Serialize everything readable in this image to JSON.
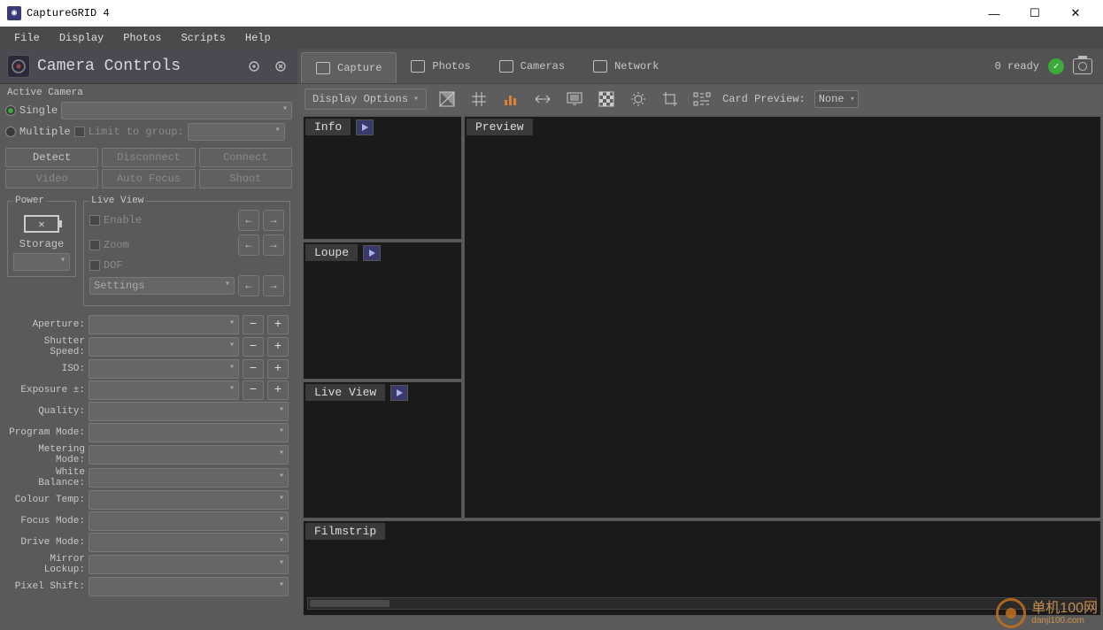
{
  "window": {
    "title": "CaptureGRID 4"
  },
  "menubar": [
    "File",
    "Display",
    "Photos",
    "Scripts",
    "Help"
  ],
  "sidebar": {
    "title": "Camera Controls",
    "active_camera_label": "Active Camera",
    "single_label": "Single",
    "multiple_label": "Multiple",
    "limit_label": "Limit to group:",
    "buttons": {
      "detect": "Detect",
      "disconnect": "Disconnect",
      "connect": "Connect",
      "video": "Video",
      "autofocus": "Auto Focus",
      "shoot": "Shoot"
    },
    "power": {
      "legend": "Power",
      "storage_label": "Storage"
    },
    "liveview": {
      "legend": "Live View",
      "enable": "Enable",
      "zoom": "Zoom",
      "dof": "DOF",
      "settings": "Settings"
    },
    "controls": [
      {
        "label": "Aperture:",
        "stepper": true
      },
      {
        "label": "Shutter Speed:",
        "stepper": true
      },
      {
        "label": "ISO:",
        "stepper": true
      },
      {
        "label": "Exposure ±:",
        "stepper": true
      },
      {
        "label": "Quality:",
        "stepper": false
      },
      {
        "label": "Program Mode:",
        "stepper": false
      },
      {
        "label": "Metering Mode:",
        "stepper": false
      },
      {
        "label": "White Balance:",
        "stepper": false
      },
      {
        "label": "Colour Temp:",
        "stepper": false
      },
      {
        "label": "Focus Mode:",
        "stepper": false
      },
      {
        "label": "Drive Mode:",
        "stepper": false
      },
      {
        "label": "Mirror Lockup:",
        "stepper": false
      },
      {
        "label": "Pixel Shift:",
        "stepper": false
      }
    ]
  },
  "tabs": [
    {
      "label": "Capture",
      "active": true
    },
    {
      "label": "Photos",
      "active": false
    },
    {
      "label": "Cameras",
      "active": false
    },
    {
      "label": "Network",
      "active": false
    }
  ],
  "status": {
    "ready": "0 ready"
  },
  "toolbar": {
    "display_options": "Display Options",
    "card_preview_label": "Card Preview:",
    "card_preview_value": "None"
  },
  "panes": {
    "info": "Info",
    "preview": "Preview",
    "loupe": "Loupe",
    "liveview": "Live View",
    "filmstrip": "Filmstrip"
  },
  "watermark": {
    "brand": "单机100网",
    "url": "danji100.com"
  }
}
